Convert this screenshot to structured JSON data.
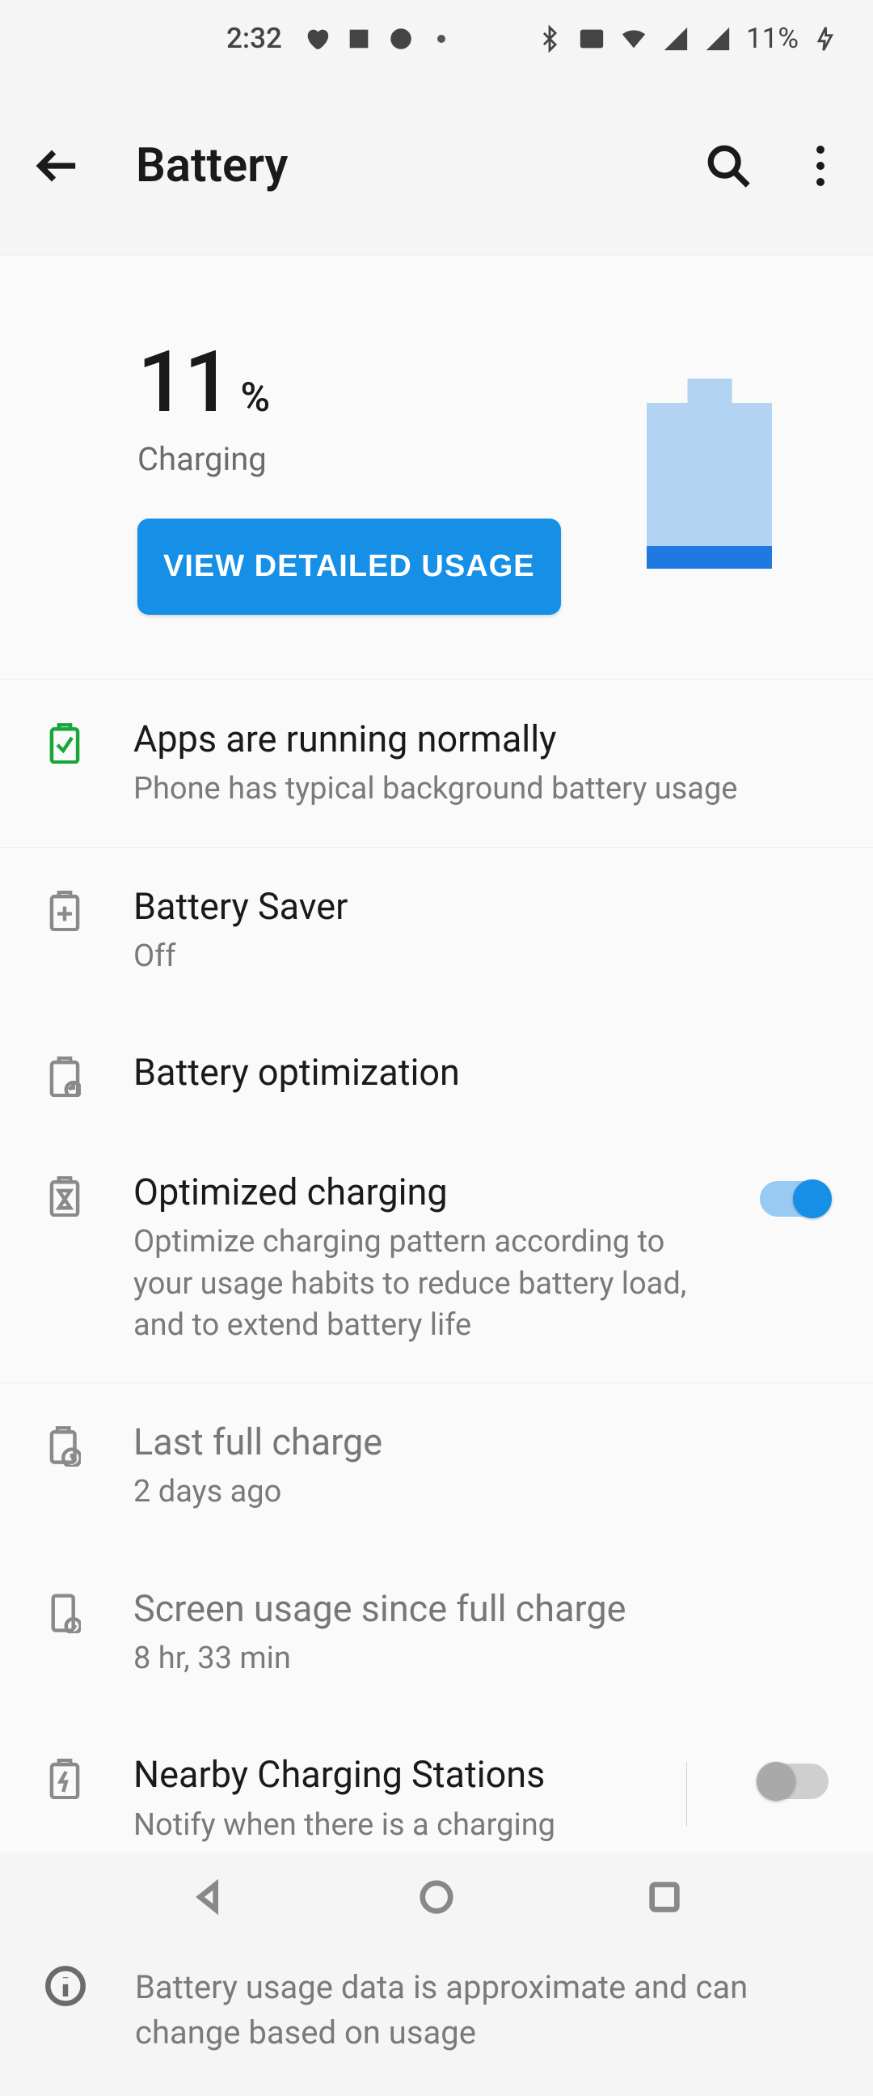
{
  "status": {
    "time": "2:32",
    "battery_percent": "11%"
  },
  "header": {
    "title": "Battery"
  },
  "level": {
    "percent": "11",
    "percent_symbol": "%",
    "status": "Charging",
    "button": "VIEW DETAILED USAGE"
  },
  "rows": {
    "apps_normal": {
      "title": "Apps are running normally",
      "sub": "Phone has typical background battery usage"
    },
    "battery_saver": {
      "title": "Battery Saver",
      "sub": "Off"
    },
    "battery_opt": {
      "title": "Battery optimization"
    },
    "opt_charging": {
      "title": "Optimized charging",
      "sub": "Optimize charging pattern according to your usage habits to reduce battery load, and to extend battery life"
    },
    "last_full": {
      "title": "Last full charge",
      "sub": "2 days ago"
    },
    "screen_usage": {
      "title": "Screen usage since full charge",
      "sub": "8 hr, 33 min"
    },
    "nearby_stations": {
      "title": "Nearby Charging Stations",
      "sub": "Notify when there is a charging station nearby"
    }
  },
  "footer": {
    "info": "Battery usage data is approximate and can change based on usage"
  }
}
